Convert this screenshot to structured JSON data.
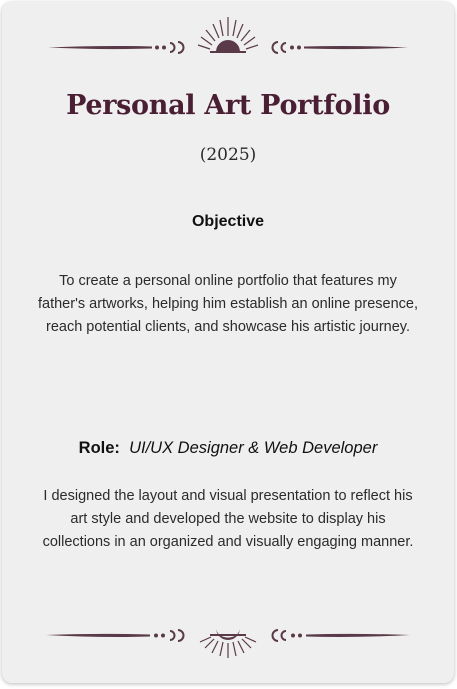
{
  "card": {
    "title": "Personal Art Portfolio",
    "year": "(2025)",
    "objective": {
      "heading": "Objective",
      "text": "To create a personal online portfolio that features my father's artworks, helping him establish an online presence, reach potential clients, and showcase his artistic journey."
    },
    "role": {
      "label": "Role:",
      "value": "UI/UX Designer & Web Developer"
    },
    "description": "I designed the layout and visual presentation to reflect his art style and developed the website to display his collections in an organized and visually engaging manner."
  },
  "colors": {
    "accent": "#4a1f33",
    "card_background": "#efefef",
    "ornament": "#5a3a48"
  },
  "icons": {
    "top_ornament": "rising-sun-ornament-icon",
    "bottom_ornament": "crescent-moon-ornament-icon"
  }
}
